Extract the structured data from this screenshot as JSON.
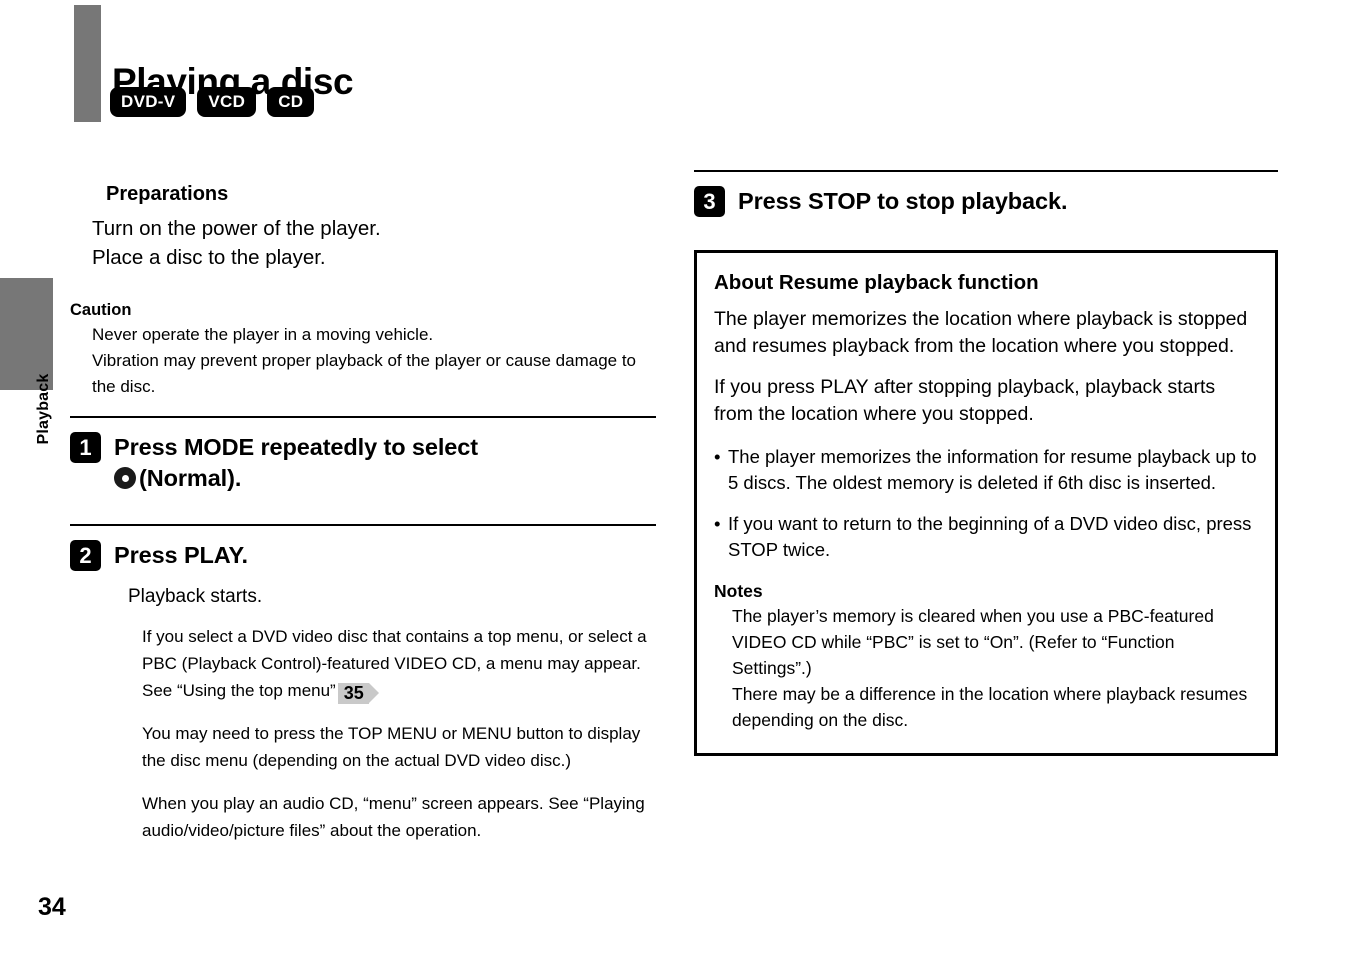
{
  "side_tab": {
    "label": "Playback"
  },
  "header": {
    "title": "Playing a disc",
    "disc_badges": [
      "DVD-V",
      "VCD",
      "CD"
    ]
  },
  "left_column": {
    "preparations_heading": "Preparations",
    "preparations_lines": [
      "Turn on the power of the player.",
      "Place a disc to the player."
    ],
    "caution_heading": "Caution",
    "caution_lines": [
      "Never operate the player in a moving vehicle.",
      "Vibration may prevent proper playback of the player or cause damage to the disc."
    ],
    "step1": {
      "number": "1",
      "title_before_icon": "Press MODE repeatedly to select",
      "icon": "disc-icon",
      "title_after_icon": "(Normal)."
    },
    "step2": {
      "number": "2",
      "title": "Press PLAY.",
      "lead": "Playback starts.",
      "notes": [
        {
          "text_before_ref": "If you select a DVD video disc that contains a top menu, or select a PBC (Playback Control)-featured VIDEO CD, a menu may appear. See “Using the top menu”",
          "page_ref": "35",
          "text_after_ref": "."
        },
        {
          "text_before_ref": "You may need to press the TOP MENU or MENU button to display the disc menu (depending on the actual DVD video disc.)",
          "page_ref": "",
          "text_after_ref": ""
        },
        {
          "text_before_ref": "When you play an audio CD, “menu” screen appears. See “Playing audio/video/picture files” about the operation.",
          "page_ref": "",
          "text_after_ref": ""
        }
      ]
    }
  },
  "right_column": {
    "step3": {
      "number": "3",
      "title": "Press STOP to stop playback."
    },
    "resume_box": {
      "title": "About Resume playback function",
      "paragraphs": [
        "The player memorizes the location where playback is stopped and resumes playback from the location where you stopped.",
        "If you press PLAY after stopping playback, playback starts from the location where you stopped."
      ],
      "bullets": [
        "The player memorizes the information for resume playback up to 5 discs. The oldest memory is deleted if 6th disc is inserted.",
        "If you want to return to the beginning of a DVD video disc, press STOP twice."
      ],
      "notes_heading": "Notes",
      "notes": [
        "The player’s memory is cleared when you use a PBC-featured VIDEO CD while “PBC” is set to “On”. (Refer to “Function Settings”.)",
        "There may be a difference in the location where playback resumes depending on the disc."
      ]
    }
  },
  "footer": {
    "page_number": "34"
  },
  "colors": {
    "accent_gray": "#777777",
    "page_ref_gray": "#c9c9c9",
    "ink": "#000000",
    "paper": "#ffffff"
  }
}
